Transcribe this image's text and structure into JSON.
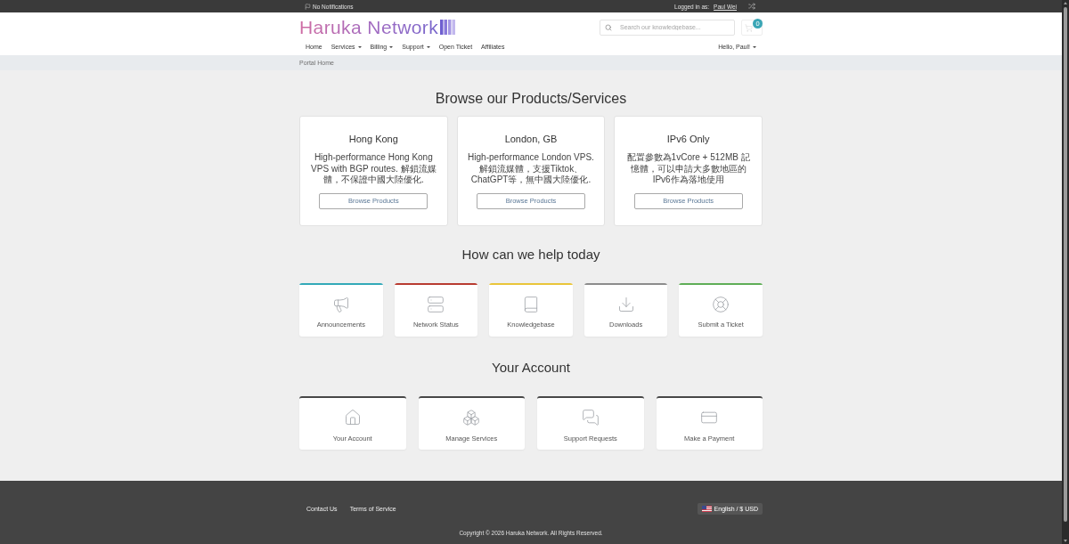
{
  "top_bar": {
    "notifications": "No Notifications",
    "logged_in_label": "Logged in as:",
    "user_name": "Paul Wei"
  },
  "header": {
    "logo": "Haruka Network",
    "search": {
      "placeholder": "Search our knowledgebase..."
    },
    "cart_count": "0"
  },
  "nav": {
    "items": [
      {
        "label": "Home",
        "has_menu": false
      },
      {
        "label": "Services",
        "has_menu": true
      },
      {
        "label": "Billing",
        "has_menu": true
      },
      {
        "label": "Support",
        "has_menu": true
      },
      {
        "label": "Open Ticket",
        "has_menu": false
      },
      {
        "label": "Affiliates",
        "has_menu": false
      }
    ],
    "user_menu": {
      "label": "Hello, Paul!",
      "has_menu": true
    }
  },
  "breadcrumb": [
    "Portal Home"
  ],
  "products": {
    "title": "Browse our Products/Services",
    "cards": [
      {
        "title": "Hong Kong",
        "description": "High-performance Hong Kong VPS with BGP routes. 解鎖流媒體，不保證中國大陸優化.",
        "button": "Browse Products"
      },
      {
        "title": "London, GB",
        "description": "High-performance London VPS. 解鎖流媒體，支援Tiktok、ChatGPT等，無中國大陸優化.",
        "button": "Browse Products"
      },
      {
        "title": "IPv6 Only",
        "description": "配置參數為1vCore + 512MB 記憶體，可以申請大多數地區的IPv6作為落地使用",
        "button": "Browse Products"
      }
    ]
  },
  "help": {
    "title": "How can we help today",
    "cards": [
      {
        "label": "Announcements",
        "color": "#33a9b8"
      },
      {
        "label": "Network Status",
        "color": "#b83b30"
      },
      {
        "label": "Knowledgebase",
        "color": "#e9c53a"
      },
      {
        "label": "Downloads",
        "color": "#8c8c8c"
      },
      {
        "label": "Submit a Ticket",
        "color": "#5fae57"
      }
    ]
  },
  "account": {
    "title": "Your Account",
    "cards": [
      {
        "label": "Your Account"
      },
      {
        "label": "Manage Services"
      },
      {
        "label": "Support Requests"
      },
      {
        "label": "Make a Payment"
      }
    ]
  },
  "footer": {
    "links": [
      "Contact Us",
      "Terms of Service"
    ],
    "language_button": "English / $ USD",
    "copyright": "Copyright © 2026 Haruka Network. All Rights Reserved."
  }
}
